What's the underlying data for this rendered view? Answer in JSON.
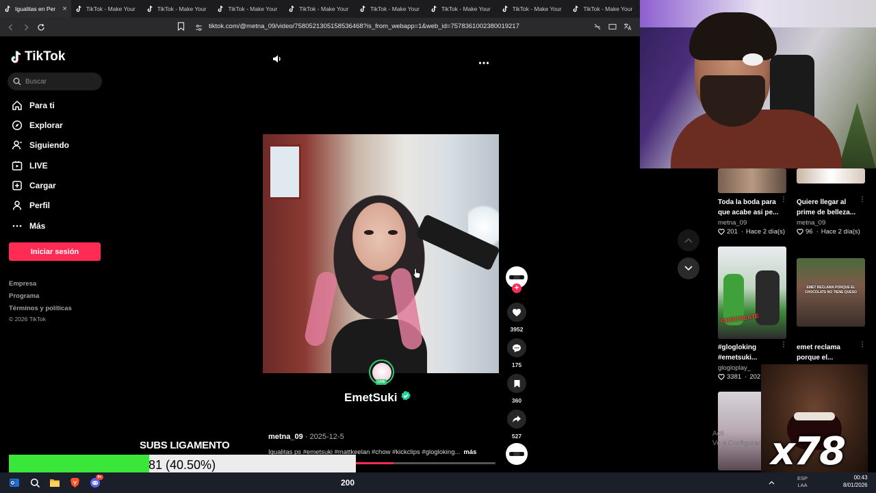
{
  "browser": {
    "tabs": [
      {
        "label": "Igualitas en Per",
        "active": true
      },
      {
        "label": "TikTok - Make Your"
      },
      {
        "label": "TikTok - Make Your"
      },
      {
        "label": "TikTok - Make Your"
      },
      {
        "label": "TikTok - Make Your"
      },
      {
        "label": "TikTok - Make Your"
      },
      {
        "label": "TikTok - Make Your"
      },
      {
        "label": "TikTok - Make Your"
      },
      {
        "label": "TikTok - Make Your"
      }
    ],
    "url": "tiktok.com/@metna_09/video/7580521305158536468?is_from_webapp=1&web_id=7578361002380019217"
  },
  "sidebar": {
    "logo": "TikTok",
    "search_placeholder": "Buscar",
    "nav": [
      {
        "label": "Para ti",
        "icon": "home-icon"
      },
      {
        "label": "Explorar",
        "icon": "compass-icon"
      },
      {
        "label": "Siguiendo",
        "icon": "following-icon"
      },
      {
        "label": "LIVE",
        "icon": "live-icon"
      },
      {
        "label": "Cargar",
        "icon": "upload-icon"
      },
      {
        "label": "Perfil",
        "icon": "profile-icon"
      },
      {
        "label": "Más",
        "icon": "more-icon"
      }
    ],
    "login": "Iniciar sesión",
    "footer": [
      "Empresa",
      "Programa",
      "Términos y políticas"
    ],
    "copyright": "© 2026 TikTok"
  },
  "video": {
    "live_badge": "LIVE",
    "channel_name": "EmetSuki",
    "author": "metna_09",
    "date": "2025-12-5",
    "caption": "Igualitas ps #emetsuki #mattkeelan #chow #kickclips #glogloking...",
    "more": "más",
    "progress": 0.55
  },
  "actions": {
    "likes": "3952",
    "comments": "175",
    "saves": "360",
    "shares": "527"
  },
  "recommendations": [
    {
      "title_l1": "Toda la boda para",
      "title_l2": "que acabe asi pe...",
      "author": "metna_09",
      "likes": "201",
      "ago": "Hace 2 día(s)"
    },
    {
      "title_l1": "Quiere llegar al",
      "title_l2": "prime de belleza...",
      "author": "metna_09",
      "likes": "96",
      "ago": "Hace 2 día(s)"
    },
    {
      "title_l1": "#glogloking",
      "title_l2": "#emetsuki...",
      "author": "glogloplay_",
      "likes": "3381",
      "ago": "202"
    },
    {
      "title_l1": "emet reclama",
      "title_l2": "porque el...",
      "author": "",
      "likes": "",
      "ago": ""
    }
  ],
  "thumb_texts": {
    "t3_caption": "CHOCOLATE",
    "t4_caption": "EMET RECLAMA PORQUE EL CHOCOLATE NO TIENE QUESO"
  },
  "overlays": {
    "goal_title": "SUBS LIGAMENTO",
    "goal_value": "81 (40.50%)",
    "goal_fraction": 0.405,
    "meme_text": "x78",
    "activate_l1": "Acti",
    "activate_l2": "Ve a Configurac"
  },
  "taskbar": {
    "count": "200",
    "lang_l1": "ESP",
    "lang_l2": "LAA",
    "time": "00:43",
    "date": "8/01/2026",
    "discord_badge": "9+"
  },
  "colors": {
    "accent": "#fe2c55",
    "goal_fill": "#3be63b",
    "verified": "#20d5a0",
    "live_ring": "#2ecc71"
  }
}
